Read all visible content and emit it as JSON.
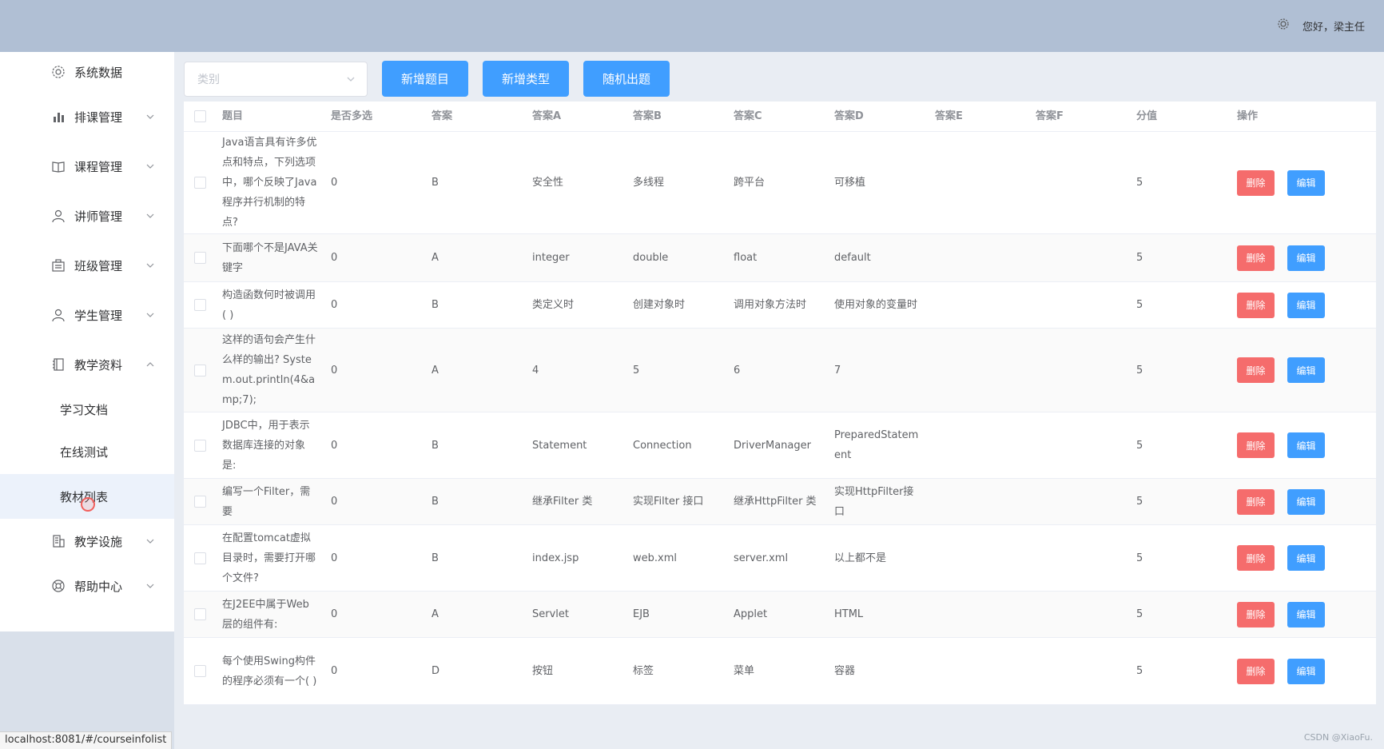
{
  "header": {
    "greeting": "您好，",
    "user": "梁主任"
  },
  "sidebar": {
    "items": [
      {
        "label": "系统数据",
        "icon": "gear-icon",
        "chevron": ""
      },
      {
        "label": "排课管理",
        "icon": "bar-chart-icon",
        "chevron": "down"
      },
      {
        "label": "课程管理",
        "icon": "book-icon",
        "chevron": "down"
      },
      {
        "label": "讲师管理",
        "icon": "user-icon",
        "chevron": "down"
      },
      {
        "label": "班级管理",
        "icon": "building-icon",
        "chevron": "down"
      },
      {
        "label": "学生管理",
        "icon": "user-icon",
        "chevron": "down"
      },
      {
        "label": "教学资料",
        "icon": "notebook-icon",
        "chevron": "up"
      }
    ],
    "submenu": [
      {
        "label": "学习文档"
      },
      {
        "label": "在线测试"
      },
      {
        "label": "教材列表"
      }
    ],
    "items_after": [
      {
        "label": "教学设施",
        "icon": "office-icon",
        "chevron": "down"
      },
      {
        "label": "帮助中心",
        "icon": "lifebuoy-icon",
        "chevron": "down"
      }
    ]
  },
  "status_bar": "localhost:8081/#/courseinfolist",
  "toolbar": {
    "select_placeholder": "类别",
    "add_question": "新增题目",
    "add_type": "新增类型",
    "random_question": "随机出题"
  },
  "table": {
    "headers": [
      "题目",
      "是否多选",
      "答案",
      "答案A",
      "答案B",
      "答案C",
      "答案D",
      "答案E",
      "答案F",
      "分值",
      "操作"
    ],
    "delete_label": "删除",
    "edit_label": "编辑",
    "rows": [
      {
        "q": "Java语言具有许多优点和特点，下列选项中，哪个反映了Java程序并行机制的特点?",
        "multi": "0",
        "ans": "B",
        "a": "安全性",
        "b": "多线程",
        "c": "跨平台",
        "d": "可移植",
        "e": "",
        "f": "",
        "score": "5"
      },
      {
        "q": "下面哪个不是JAVA关键字",
        "multi": "0",
        "ans": "A",
        "a": "integer",
        "b": "double",
        "c": "float",
        "d": "default",
        "e": "",
        "f": "",
        "score": "5"
      },
      {
        "q": "构造函数何时被调用( )",
        "multi": "0",
        "ans": "B",
        "a": "类定义时",
        "b": "创建对象时",
        "c": "调用对象方法时",
        "d": "使用对象的变量时",
        "e": "",
        "f": "",
        "score": "5"
      },
      {
        "q": "这样的语句会产生什么样的输出? System.out.println(4&amp;7);",
        "multi": "0",
        "ans": "A",
        "a": "4",
        "b": "5",
        "c": "6",
        "d": "7",
        "e": "",
        "f": "",
        "score": "5"
      },
      {
        "q": "JDBC中，用于表示数据库连接的对象是:",
        "multi": "0",
        "ans": "B",
        "a": "Statement",
        "b": "Connection",
        "c": "DriverManager",
        "d": "PreparedStatement",
        "e": "",
        "f": "",
        "score": "5"
      },
      {
        "q": "编写一个Filter，需要",
        "multi": "0",
        "ans": "B",
        "a": "继承Filter 类",
        "b": "实现Filter 接口",
        "c": "继承HttpFilter 类",
        "d": "实现HttpFilter接口",
        "e": "",
        "f": "",
        "score": "5"
      },
      {
        "q": "在配置tomcat虚拟目录时，需要打开哪个文件?",
        "multi": "0",
        "ans": "B",
        "a": "index.jsp",
        "b": "web.xml",
        "c": "server.xml",
        "d": "以上都不是",
        "e": "",
        "f": "",
        "score": "5"
      },
      {
        "q": "在J2EE中属于Web层的组件有:",
        "multi": "0",
        "ans": "A",
        "a": "Servlet",
        "b": "EJB",
        "c": "Applet",
        "d": "HTML",
        "e": "",
        "f": "",
        "score": "5"
      },
      {
        "q": "每个使用Swing构件的程序必须有一个( )",
        "multi": "0",
        "ans": "D",
        "a": "按钮",
        "b": "标签",
        "c": "菜单",
        "d": "容器",
        "e": "",
        "f": "",
        "score": "5"
      }
    ]
  },
  "watermark": "CSDN @XiaoFu."
}
